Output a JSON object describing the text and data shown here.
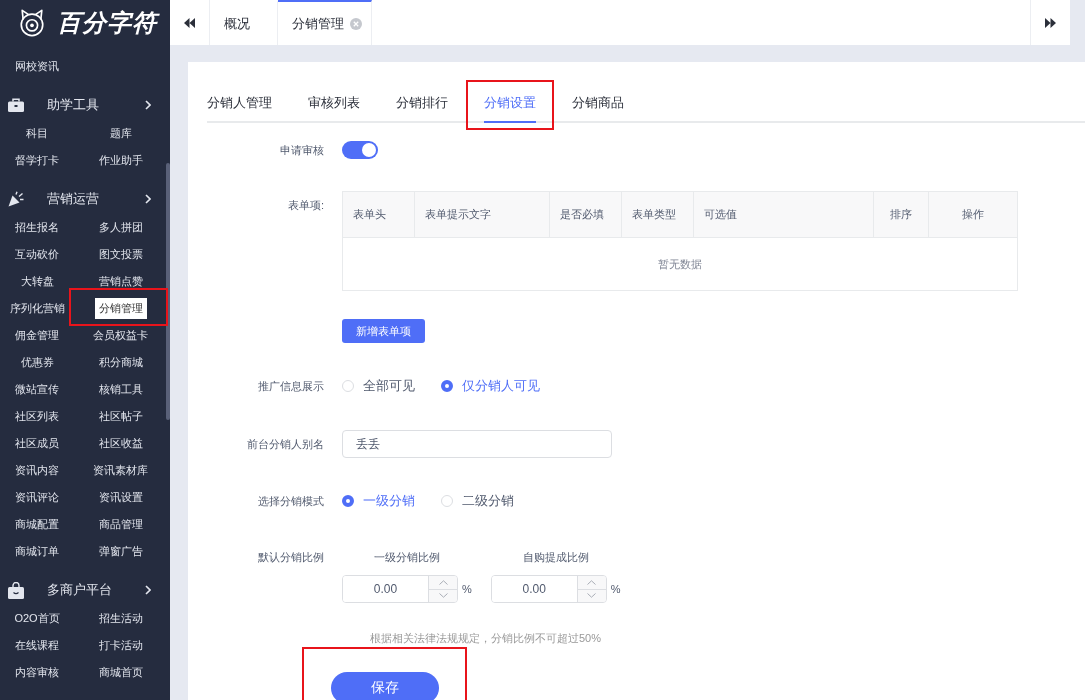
{
  "sidebar": {
    "logo": {
      "text": "百分字符"
    },
    "items": [
      {
        "label": "网校资讯",
        "selected": false,
        "annotated": false
      }
    ],
    "sections": [
      {
        "title": "助学工具",
        "items": [
          {
            "label": "科目",
            "selected": false,
            "annotated": false
          },
          {
            "label": "题库",
            "selected": false,
            "annotated": false
          },
          {
            "label": "督学打卡",
            "selected": false,
            "annotated": false
          },
          {
            "label": "作业助手",
            "selected": false,
            "annotated": false
          }
        ]
      },
      {
        "title": "营销运营",
        "items": [
          {
            "label": "招生报名",
            "selected": false,
            "annotated": false
          },
          {
            "label": "多人拼团",
            "selected": false,
            "annotated": false
          },
          {
            "label": "互动砍价",
            "selected": false,
            "annotated": false
          },
          {
            "label": "图文投票",
            "selected": false,
            "annotated": false
          },
          {
            "label": "大转盘",
            "selected": false,
            "annotated": false
          },
          {
            "label": "营销点赞",
            "selected": false,
            "annotated": false
          },
          {
            "label": "序列化营销",
            "selected": false,
            "annotated": false
          },
          {
            "label": "分销管理",
            "selected": true,
            "annotated": true
          },
          {
            "label": "佣金管理",
            "selected": false,
            "annotated": false
          },
          {
            "label": "会员权益卡",
            "selected": false,
            "annotated": false
          },
          {
            "label": "优惠券",
            "selected": false,
            "annotated": false
          },
          {
            "label": "积分商城",
            "selected": false,
            "annotated": false
          },
          {
            "label": "微站宣传",
            "selected": false,
            "annotated": false
          },
          {
            "label": "核销工具",
            "selected": false,
            "annotated": false
          },
          {
            "label": "社区列表",
            "selected": false,
            "annotated": false
          },
          {
            "label": "社区帖子",
            "selected": false,
            "annotated": false
          },
          {
            "label": "社区成员",
            "selected": false,
            "annotated": false
          },
          {
            "label": "社区收益",
            "selected": false,
            "annotated": false
          },
          {
            "label": "资讯内容",
            "selected": false,
            "annotated": false
          },
          {
            "label": "资讯素材库",
            "selected": false,
            "annotated": false
          },
          {
            "label": "资讯评论",
            "selected": false,
            "annotated": false
          },
          {
            "label": "资讯设置",
            "selected": false,
            "annotated": false
          },
          {
            "label": "商城配置",
            "selected": false,
            "annotated": false
          },
          {
            "label": "商品管理",
            "selected": false,
            "annotated": false
          },
          {
            "label": "商城订单",
            "selected": false,
            "annotated": false
          },
          {
            "label": "弹窗广告",
            "selected": false,
            "annotated": false
          }
        ]
      },
      {
        "title": "多商户平台",
        "items": [
          {
            "label": "O2O首页",
            "selected": false,
            "annotated": false
          },
          {
            "label": "招生活动",
            "selected": false,
            "annotated": false
          },
          {
            "label": "在线课程",
            "selected": false,
            "annotated": false
          },
          {
            "label": "打卡活动",
            "selected": false,
            "annotated": false
          },
          {
            "label": "内容审核",
            "selected": false,
            "annotated": false
          },
          {
            "label": "商城首页",
            "selected": false,
            "annotated": false
          }
        ]
      }
    ]
  },
  "tabs": [
    {
      "label": "概况",
      "selected": false,
      "closable": false
    },
    {
      "label": "分销管理",
      "selected": true,
      "closable": true
    }
  ],
  "page_tabs": [
    {
      "label": "分销人管理",
      "selected": false,
      "annotated": false
    },
    {
      "label": "审核列表",
      "selected": false,
      "annotated": false
    },
    {
      "label": "分销排行",
      "selected": false,
      "annotated": false
    },
    {
      "label": "分销设置",
      "selected": true,
      "annotated": true
    },
    {
      "label": "分销商品",
      "selected": false,
      "annotated": false
    }
  ],
  "form": {
    "fields": [
      {
        "kind": "switch",
        "label": "申请审核",
        "on": true
      },
      {
        "kind": "table",
        "label": "表单项:",
        "columns": [
          "表单头",
          "表单提示文字",
          "是否必填",
          "表单类型",
          "可选值",
          "排序",
          "操作"
        ],
        "empty_text": "暂无数据",
        "add_button": "新增表单项"
      },
      {
        "kind": "radio",
        "label": "推广信息展示",
        "options": [
          {
            "label": "全部可见",
            "selected": false
          },
          {
            "label": "仅分销人可见",
            "selected": true
          }
        ]
      },
      {
        "kind": "text",
        "label": "前台分销人别名",
        "value": "丢丢"
      },
      {
        "kind": "radio",
        "label": "选择分销模式",
        "options": [
          {
            "label": "一级分销",
            "selected": true
          },
          {
            "label": "二级分销",
            "selected": false
          }
        ]
      },
      {
        "kind": "ratios",
        "label": "默认分销比例",
        "inputs": [
          {
            "label": "一级分销比例",
            "value": "0.00",
            "unit": "%"
          },
          {
            "label": "自购提成比例",
            "value": "0.00",
            "unit": "%"
          }
        ],
        "hint": "根据相关法律法规规定，分销比例不可超过50%"
      }
    ],
    "save_button": {
      "label": "保存",
      "annotated": true
    }
  }
}
